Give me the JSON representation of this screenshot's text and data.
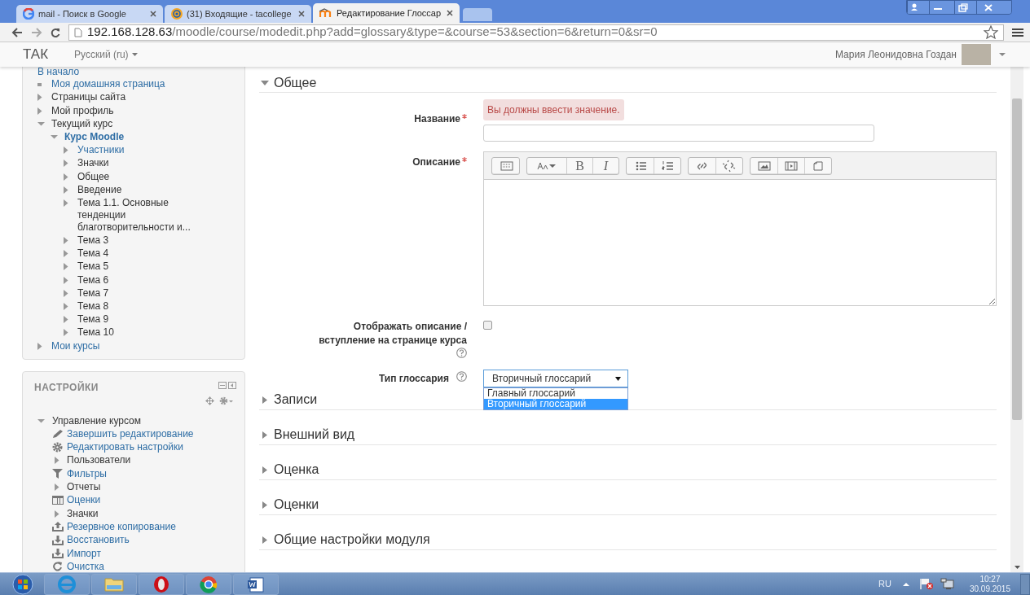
{
  "browser": {
    "tabs": [
      {
        "title": "mail - Поиск в Google",
        "kind": "google",
        "selected": false
      },
      {
        "title": "(31) Входящие - tacollege",
        "kind": "mail",
        "selected": false
      },
      {
        "title": "Редактирование Глоссар",
        "kind": "moodle",
        "selected": true
      }
    ],
    "url_host": "192.168.128.63",
    "url_path": "/moodle/course/modedit.php?add=glossary&type=&course=53&section=6&return=0&sr=0"
  },
  "navbar": {
    "brand": "ТАК",
    "language": "Русский (ru)",
    "user": "Мария Леонидовна Гоздан"
  },
  "navigation": {
    "home": "В начало",
    "items": [
      {
        "label": "Моя домашняя страница",
        "kind": "leaf"
      },
      {
        "label": "Страницы сайта",
        "kind": "branch",
        "expanded": false
      },
      {
        "label": "Мой профиль",
        "kind": "branch",
        "expanded": false
      },
      {
        "label": "Текущий курс",
        "kind": "branch",
        "expanded": true,
        "children": [
          {
            "label": "Курс Moodle",
            "kind": "current",
            "expanded": true,
            "children": [
              {
                "label": "Участники",
                "kind": "link",
                "expanded": false
              },
              {
                "label": "Значки",
                "kind": "branch",
                "expanded": false
              },
              {
                "label": "Общее",
                "kind": "branch",
                "expanded": false
              },
              {
                "label": "Введение",
                "kind": "branch",
                "expanded": false
              },
              {
                "label": "Тема 1.1. Основные тенденции благотворительности и...",
                "kind": "branch",
                "expanded": false
              },
              {
                "label": "Тема 3",
                "kind": "branch",
                "expanded": false
              },
              {
                "label": "Тема 4",
                "kind": "branch",
                "expanded": false
              },
              {
                "label": "Тема 5",
                "kind": "branch",
                "expanded": false
              },
              {
                "label": "Тема 6",
                "kind": "branch",
                "expanded": false
              },
              {
                "label": "Тема 7",
                "kind": "branch",
                "expanded": false
              },
              {
                "label": "Тема 8",
                "kind": "branch",
                "expanded": false
              },
              {
                "label": "Тема 9",
                "kind": "branch",
                "expanded": false
              },
              {
                "label": "Тема 10",
                "kind": "branch",
                "expanded": false
              }
            ]
          }
        ]
      },
      {
        "label": "Мои курсы",
        "kind": "link",
        "expanded": false
      }
    ]
  },
  "settings": {
    "title": "НАСТРОЙКИ",
    "items": [
      {
        "label": "Управление курсом",
        "kind": "branch",
        "expanded": true,
        "children": [
          {
            "label": "Завершить редактирование",
            "kind": "edit"
          },
          {
            "label": "Редактировать настройки",
            "kind": "settings"
          },
          {
            "label": "Пользователи",
            "kind": "branch",
            "expanded": false
          },
          {
            "label": "Фильтры",
            "kind": "filter"
          },
          {
            "label": "Отчеты",
            "kind": "branch",
            "expanded": false
          },
          {
            "label": "Оценки",
            "kind": "grades"
          },
          {
            "label": "Значки",
            "kind": "branch",
            "expanded": false
          },
          {
            "label": "Резервное копирование",
            "kind": "backup"
          },
          {
            "label": "Восстановить",
            "kind": "restore"
          },
          {
            "label": "Импорт",
            "kind": "import"
          },
          {
            "label": "Очистка",
            "kind": "reset"
          }
        ]
      }
    ]
  },
  "form": {
    "section": {
      "title": "Общее",
      "expanded": true
    },
    "name": {
      "label": "Название",
      "required": true,
      "error": "Вы должны ввести значение."
    },
    "description": {
      "label": "Описание",
      "required": true,
      "toolbar": [
        [
          {
            "kind": "collapse"
          }
        ],
        [
          {
            "kind": "style"
          },
          {
            "kind": "bold",
            "label": "B"
          },
          {
            "kind": "italic",
            "label": "I"
          }
        ],
        [
          {
            "kind": "ul"
          },
          {
            "kind": "ol"
          }
        ],
        [
          {
            "kind": "link"
          },
          {
            "kind": "unlink"
          }
        ],
        [
          {
            "kind": "image"
          },
          {
            "kind": "media"
          },
          {
            "kind": "files"
          }
        ]
      ]
    },
    "show_description": {
      "label": "Отображать описание / вступление на странице курса",
      "checked": false
    },
    "glossary_type": {
      "label": "Тип глоссария",
      "value": "Вторичный глоссарий",
      "open": true,
      "options": [
        {
          "label": "Главный глоссарий",
          "selected": false
        },
        {
          "label": "Вторичный глоссарий",
          "selected": true
        }
      ]
    }
  },
  "sections": [
    {
      "title": "Записи",
      "expanded": false
    },
    {
      "title": "Внешний вид",
      "expanded": false
    },
    {
      "title": "Оценка",
      "expanded": false
    },
    {
      "title": "Оценки",
      "expanded": false
    },
    {
      "title": "Общие настройки модуля",
      "expanded": false
    }
  ],
  "taskbar": {
    "apps": [
      {
        "kind": "ie"
      },
      {
        "kind": "folder"
      },
      {
        "kind": "opera"
      },
      {
        "kind": "chrome"
      },
      {
        "kind": "word"
      }
    ],
    "language": "RU",
    "time": "10:27",
    "date": "30.09.2015"
  }
}
